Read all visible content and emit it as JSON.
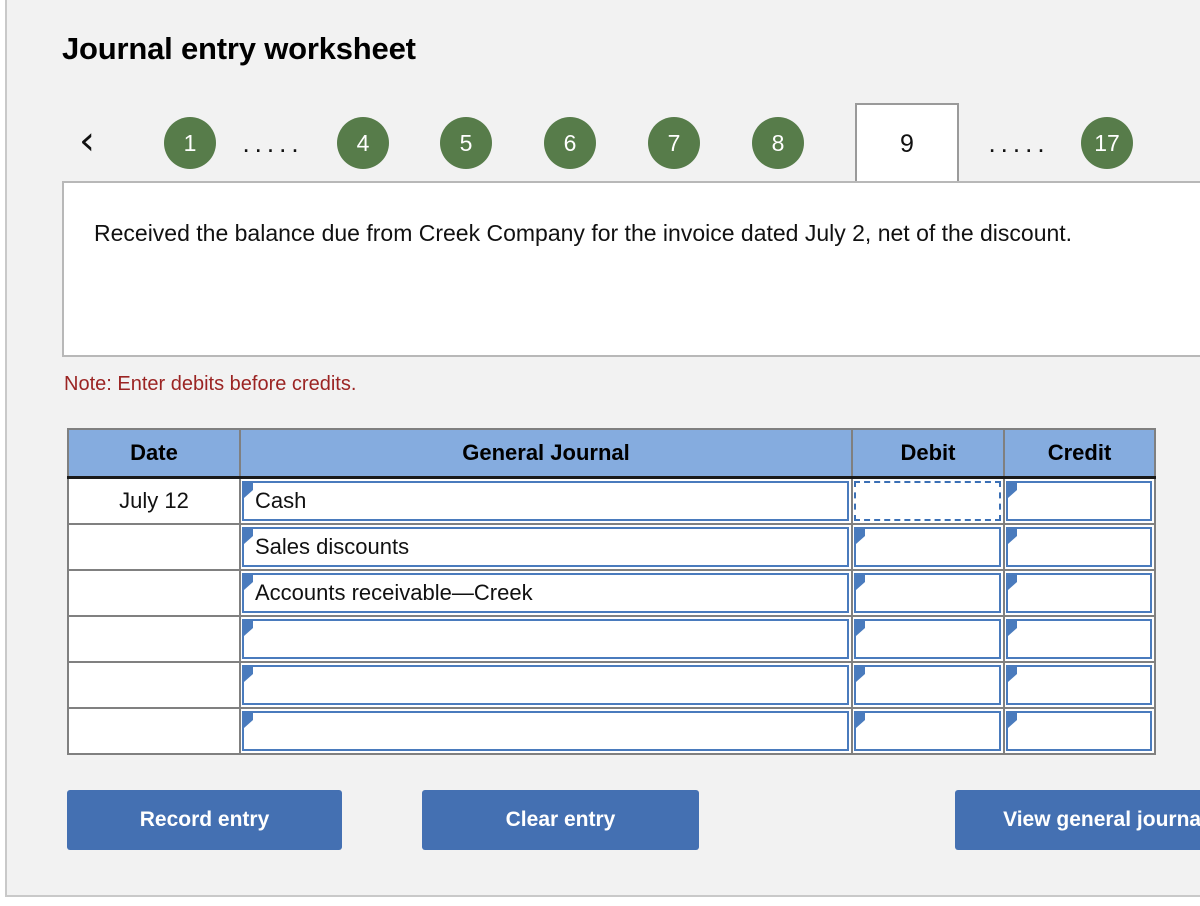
{
  "header": {
    "title": "Journal entry worksheet"
  },
  "stepper": {
    "prev_icon": "chevron-left-icon",
    "prev_glyph": "‹",
    "ellipsis": ".....",
    "steps": [
      {
        "label": "1",
        "state": "done"
      },
      {
        "label": "...",
        "state": "ellipsis"
      },
      {
        "label": "4",
        "state": "done"
      },
      {
        "label": "5",
        "state": "done"
      },
      {
        "label": "6",
        "state": "done"
      },
      {
        "label": "7",
        "state": "done"
      },
      {
        "label": "8",
        "state": "done"
      },
      {
        "label": "9",
        "state": "active"
      },
      {
        "label": "...",
        "state": "ellipsis"
      },
      {
        "label": "17",
        "state": "done"
      }
    ],
    "active_step": "9",
    "done_color": "#577c4a",
    "active_bg": "#ffffff"
  },
  "description": {
    "text": "Received the balance due from Creek Company for the invoice dated July 2, net of the discount."
  },
  "note": {
    "text": "Note: Enter debits before credits.",
    "color": "#9b2423"
  },
  "journal": {
    "columns": [
      "Date",
      "General Journal",
      "Debit",
      "Credit"
    ],
    "header_bg": "#85acdf",
    "rows": [
      {
        "date": "July 12",
        "account": "Cash",
        "debit": "",
        "credit": "",
        "debit_focused": true
      },
      {
        "date": "",
        "account": "Sales discounts",
        "debit": "",
        "credit": "",
        "debit_focused": false
      },
      {
        "date": "",
        "account": "Accounts receivable—Creek",
        "debit": "",
        "credit": "",
        "debit_focused": false
      },
      {
        "date": "",
        "account": "",
        "debit": "",
        "credit": "",
        "debit_focused": false
      },
      {
        "date": "",
        "account": "",
        "debit": "",
        "credit": "",
        "debit_focused": false
      },
      {
        "date": "",
        "account": "",
        "debit": "",
        "credit": "",
        "debit_focused": false
      }
    ]
  },
  "actions": {
    "record_label": "Record entry",
    "clear_label": "Clear entry",
    "view_label": "View general journal",
    "button_color": "#4470b2"
  }
}
